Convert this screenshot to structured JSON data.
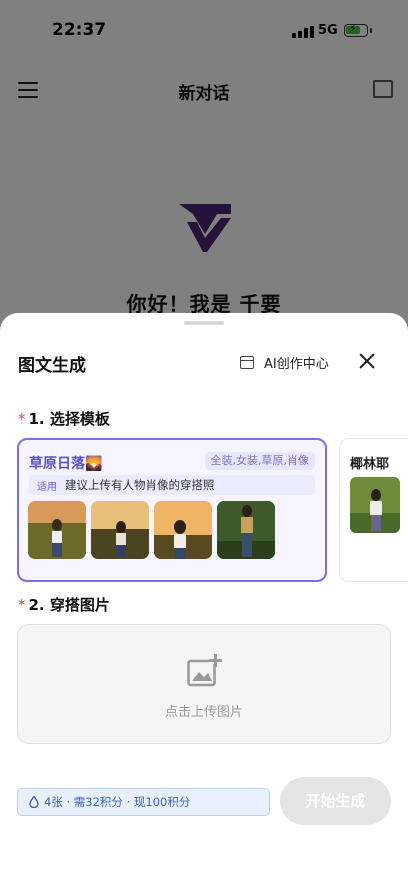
{
  "status_bar": {
    "time": "22:37",
    "network": "5G"
  },
  "nav": {
    "title": "新对话"
  },
  "chat": {
    "greeting": "你好！我是 千要"
  },
  "sheet": {
    "title": "图文生成",
    "ai_center_label": "AI创作中心",
    "section1": {
      "number": "1. 选择模板",
      "required_mark": "*"
    },
    "section2": {
      "number": "2. 穿搭图片",
      "required_mark": "*"
    },
    "templates": [
      {
        "title": "草原日落🌄",
        "tags": "全装,女装,草原,肖像",
        "hint_tag": "适用",
        "hint": "建议上传有人物肖像的穿搭照",
        "selected": true
      },
      {
        "title": "椰林耶",
        "selected": false
      }
    ],
    "upload": {
      "label": "点击上传图片",
      "icon": "add-image-icon"
    },
    "credits": "4张 · 需32积分 · 现100积分",
    "generate_button": "开始生成"
  },
  "colors": {
    "accent": "#7c6fde",
    "credits_text": "#3b62c7",
    "required": "#e54545",
    "logo": "#4a2370"
  }
}
